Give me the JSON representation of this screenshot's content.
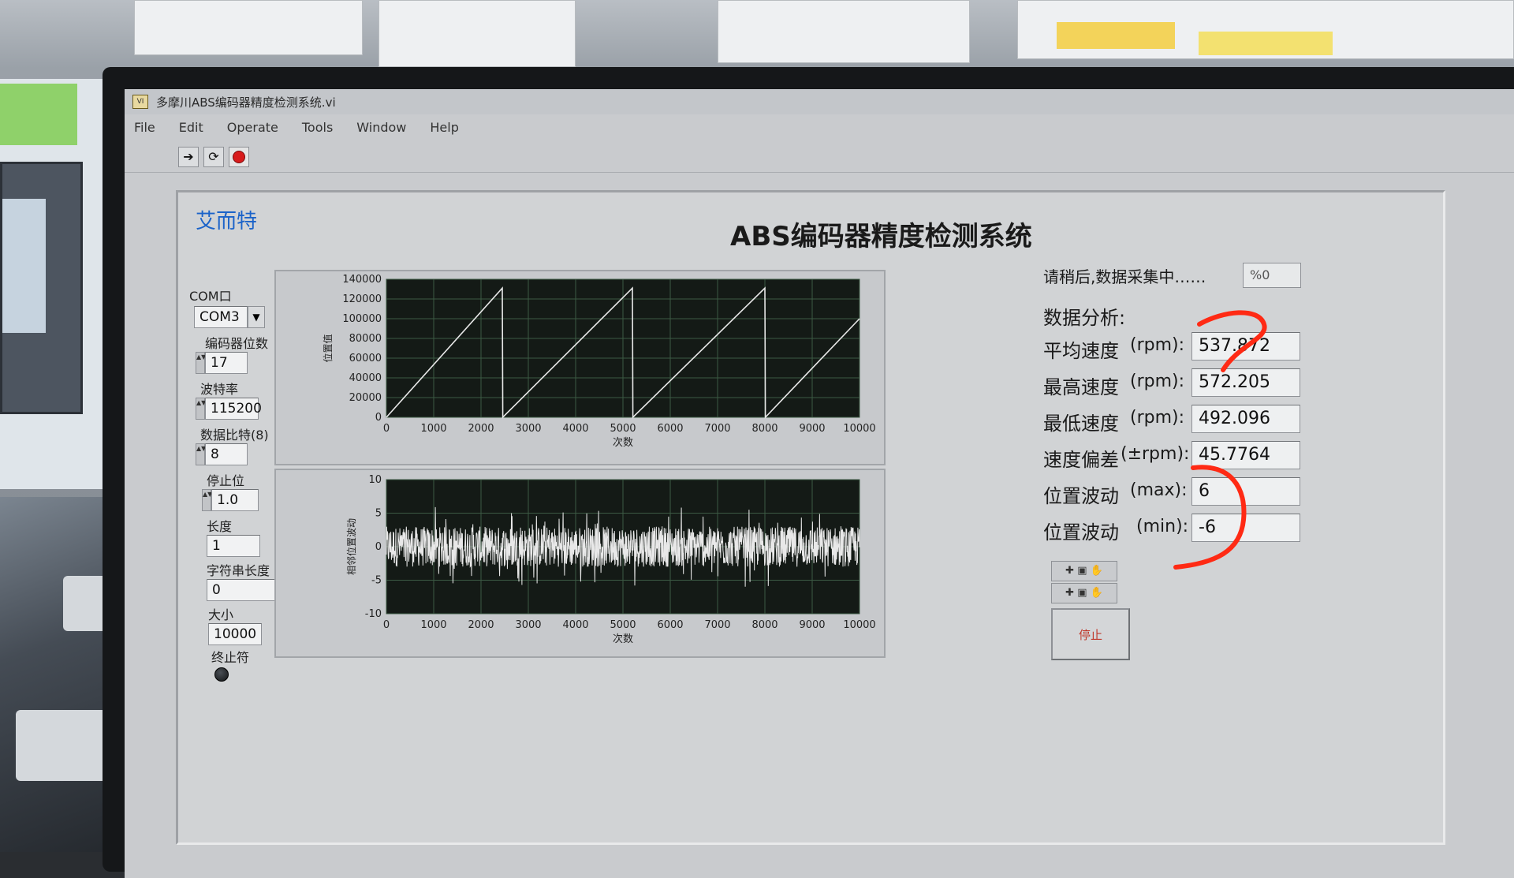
{
  "window": {
    "title": "多摩川ABS编码器精度检测系统.vi",
    "menus": [
      "File",
      "Edit",
      "Operate",
      "Tools",
      "Window",
      "Help"
    ]
  },
  "toolbar": {
    "run_icon": "run-arrow-icon",
    "continuous_icon": "run-continuous-icon",
    "abort_icon": "abort-icon"
  },
  "panel": {
    "brand": "艾而特",
    "title": "ABS编码器精度检测系统"
  },
  "config": {
    "com_label": "COM口",
    "com_value": "COM3",
    "bits_label": "编码器位数",
    "bits_value": "17",
    "baud_label": "波特率",
    "baud_value": "115200",
    "databits_label": "数据比特(8)",
    "databits_value": "8",
    "stopbits_label": "停止位",
    "stopbits_value": "1.0",
    "length_label": "长度",
    "length_value": "1",
    "strlen_label": "字符串长度",
    "strlen_value": "0",
    "size_label": "大小",
    "size_value": "10000",
    "terminator_label": "终止符"
  },
  "status": {
    "text": "请稍后,数据采集中……",
    "percent": "%0"
  },
  "analysis": {
    "heading": "数据分析:",
    "rows": [
      {
        "label": "平均速度",
        "unit": "(rpm):",
        "value": "537.872"
      },
      {
        "label": "最高速度",
        "unit": "(rpm):",
        "value": "572.205"
      },
      {
        "label": "最低速度",
        "unit": "(rpm):",
        "value": "492.096"
      },
      {
        "label": "速度偏差",
        "unit": "(±rpm):",
        "value": "45.7764"
      },
      {
        "label": "位置波动",
        "unit": "(max):",
        "value": "6"
      },
      {
        "label": "位置波动",
        "unit": "(min):",
        "value": "-6"
      }
    ],
    "stop_label": "停止"
  },
  "chart_data": [
    {
      "type": "line",
      "xlabel": "次数",
      "ylabel": "位置值",
      "xlim": [
        0,
        10000
      ],
      "ylim": [
        0,
        140000
      ],
      "x_ticks": [
        "0",
        "1000",
        "2000",
        "3000",
        "4000",
        "5000",
        "6000",
        "7000",
        "8000",
        "9000",
        "10000"
      ],
      "y_ticks": [
        "0",
        "20000",
        "40000",
        "60000",
        "80000",
        "100000",
        "120000",
        "140000"
      ],
      "series": [
        {
          "x": [
            0,
            2450,
            2460,
            5200,
            5210,
            8000,
            8010,
            10000
          ],
          "y": [
            0,
            131072,
            0,
            131072,
            0,
            131072,
            0,
            100000
          ]
        }
      ],
      "grid": true
    },
    {
      "type": "line",
      "xlabel": "次数",
      "ylabel": "相邻位置波动",
      "xlim": [
        0,
        10000
      ],
      "ylim": [
        -10,
        10
      ],
      "x_ticks": [
        "0",
        "1000",
        "2000",
        "3000",
        "4000",
        "5000",
        "6000",
        "7000",
        "8000",
        "9000",
        "10000"
      ],
      "y_ticks": [
        "-10",
        "-5",
        "0",
        "5",
        "10"
      ],
      "noise_range": [
        -6,
        6
      ],
      "grid": true
    }
  ],
  "colors": {
    "plot_bg": "#141a16",
    "grid": "#3c5a44",
    "trace": "#e8e8e8",
    "brand": "#1b63c9",
    "annotation": "#ff2a14"
  }
}
